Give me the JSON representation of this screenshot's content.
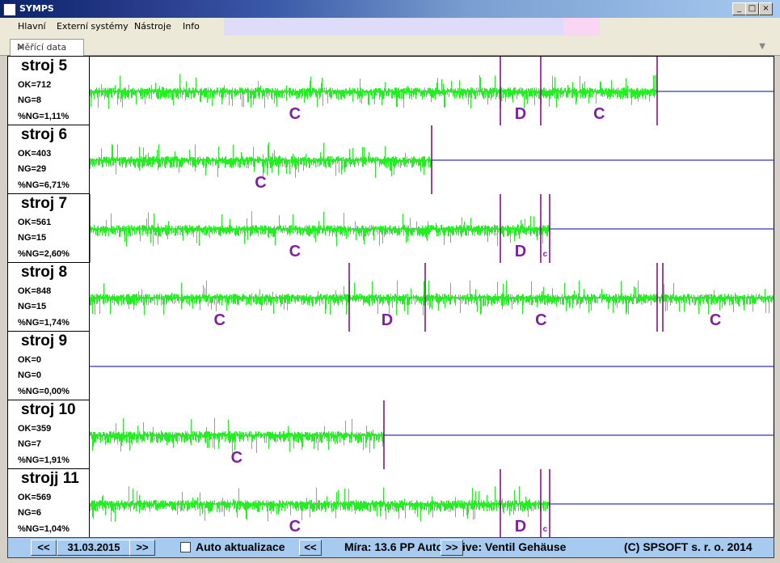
{
  "window": {
    "title": "SYMPS"
  },
  "menu": [
    "Hlavní",
    "Externí systémy",
    "Nástroje",
    "Info"
  ],
  "tab": {
    "label": "Měřící data",
    "close": "✕"
  },
  "machines": [
    {
      "name": "stroj 5",
      "ok": "OK=712",
      "ng": "NG=8",
      "pct": "%NG=1,11%",
      "active": true,
      "segments": [
        {
          "s": 0,
          "e": 0.6,
          "label": "C"
        },
        {
          "s": 0.6,
          "e": 0.66,
          "label": "D"
        },
        {
          "s": 0.66,
          "e": 0.83,
          "label": "C"
        }
      ],
      "markers": [
        0.6,
        0.66,
        0.83
      ]
    },
    {
      "name": "stroj 6",
      "ok": "OK=403",
      "ng": "NG=29",
      "pct": "%NG=6,71%",
      "active": true,
      "segments": [
        {
          "s": 0,
          "e": 0.5,
          "label": "C"
        }
      ],
      "markers": [
        0.5
      ]
    },
    {
      "name": "stroj 7",
      "ok": "OK=561",
      "ng": "NG=15",
      "pct": "%NG=2,60%",
      "active": true,
      "segments": [
        {
          "s": 0,
          "e": 0.6,
          "label": "C"
        },
        {
          "s": 0.6,
          "e": 0.66,
          "label": "D"
        },
        {
          "s": 0.66,
          "e": 0.672,
          "label": "c"
        }
      ],
      "markers": [
        0,
        0.6,
        0.66,
        0.672
      ]
    },
    {
      "name": "stroj 8",
      "ok": "OK=848",
      "ng": "NG=15",
      "pct": "%NG=1,74%",
      "active": true,
      "segments": [
        {
          "s": 0,
          "e": 0.38,
          "label": "C"
        },
        {
          "s": 0.38,
          "e": 0.49,
          "label": "D"
        },
        {
          "s": 0.49,
          "e": 0.83,
          "label": "C"
        },
        {
          "s": 0.83,
          "e": 1,
          "label": "C"
        }
      ],
      "markers": [
        0.38,
        0.49,
        0.83,
        0.838
      ]
    },
    {
      "name": "stroj 9",
      "ok": "OK=0",
      "ng": "NG=0",
      "pct": "%NG=0,00%",
      "active": false,
      "segments": [],
      "markers": []
    },
    {
      "name": "stroj 10",
      "ok": "OK=359",
      "ng": "NG=7",
      "pct": "%NG=1,91%",
      "active": true,
      "segments": [
        {
          "s": 0,
          "e": 0.43,
          "label": "C"
        }
      ],
      "markers": [
        0.43
      ]
    },
    {
      "name": "strojj 11",
      "ok": "OK=569",
      "ng": "NG=6",
      "pct": "%NG=1,04%",
      "active": true,
      "segments": [
        {
          "s": 0,
          "e": 0.6,
          "label": "C"
        },
        {
          "s": 0.6,
          "e": 0.66,
          "label": "D"
        },
        {
          "s": 0.66,
          "e": 0.672,
          "label": "c"
        }
      ],
      "markers": [
        0.6,
        0.66,
        0.672
      ]
    }
  ],
  "status": {
    "prev": "<<",
    "date": "31.03.2015",
    "next": ">>",
    "auto_label": "Auto aktualizace",
    "prev2": "<<",
    "mira_text": "Míra: 13.6 PP Auto",
    "next2": ">>",
    "product_text": "ive: Ventil Gehäuse",
    "copyright": "(C) SPSOFT s. r. o. 2014"
  },
  "colors": {
    "signal": "#22ee22",
    "baseline": "#0000aa",
    "marker": "#800080",
    "label": "#8020a0",
    "highlight": "#e8e800"
  }
}
